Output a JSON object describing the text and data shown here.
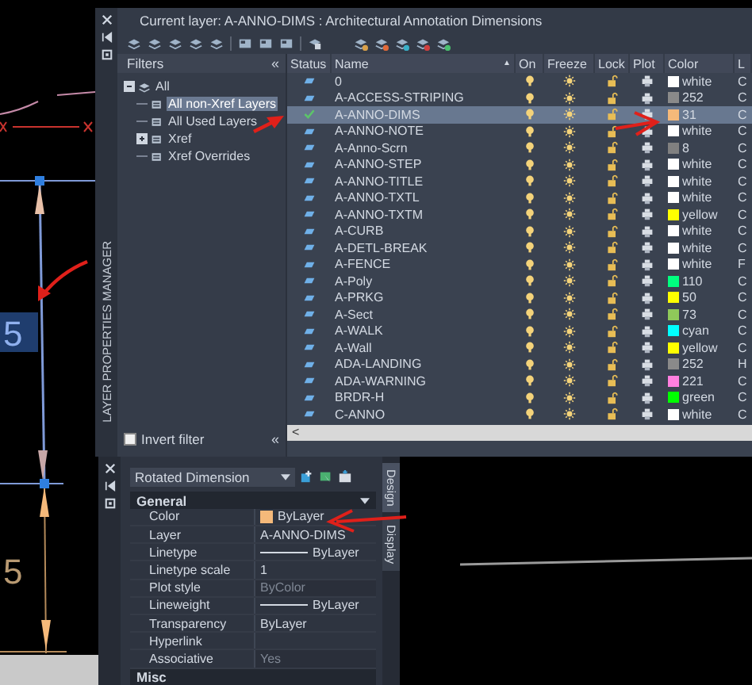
{
  "canvas": {
    "dimension_labels": [
      {
        "text": "5",
        "selected": true
      },
      {
        "text": "5",
        "selected": false
      }
    ]
  },
  "layer_manager": {
    "panel_title": "LAYER PROPERTIES MANAGER",
    "current_layer": "Current layer: A-ANNO-DIMS : Architectural Annotation Dimensions",
    "filters": {
      "title": "Filters",
      "collapse": "«",
      "tree": [
        {
          "label": "All",
          "expanded": true,
          "selected": false,
          "children": [
            {
              "label": "All non-Xref Layers",
              "selected": true
            },
            {
              "label": "All Used Layers",
              "selected": false
            },
            {
              "label": "Xref",
              "selected": false,
              "expanded": false
            },
            {
              "label": "Xref Overrides",
              "selected": false
            }
          ]
        }
      ],
      "invert_filter": {
        "label": "Invert filter",
        "checked": false
      },
      "collapse_button": "«"
    },
    "table": {
      "columns": [
        "Status",
        "Name",
        "On",
        "Freeze",
        "Lock",
        "Plot",
        "Color",
        "L"
      ],
      "sort_indicator": "▲",
      "scroll_left": "<",
      "rows": [
        {
          "name": "0",
          "current": false,
          "selected": false,
          "on": true,
          "frozen": false,
          "locked": false,
          "plot": true,
          "color_name": "white",
          "color": "#ffffff",
          "column_9": "C"
        },
        {
          "name": "A-ACCESS-STRIPING",
          "current": false,
          "selected": false,
          "on": true,
          "frozen": false,
          "locked": false,
          "plot": true,
          "color_name": "252",
          "color": "#8a8a8a",
          "column_9": "C"
        },
        {
          "name": "A-ANNO-DIMS",
          "current": true,
          "selected": true,
          "on": true,
          "frozen": false,
          "locked": false,
          "plot": true,
          "color_name": "31",
          "color": "#f5b97a",
          "column_9": "C"
        },
        {
          "name": "A-ANNO-NOTE",
          "current": false,
          "selected": false,
          "on": true,
          "frozen": false,
          "locked": false,
          "plot": true,
          "color_name": "white",
          "color": "#ffffff",
          "column_9": "C"
        },
        {
          "name": "A-Anno-Scrn",
          "current": false,
          "selected": false,
          "on": true,
          "frozen": false,
          "locked": false,
          "plot": true,
          "color_name": "8",
          "color": "#808080",
          "column_9": "C"
        },
        {
          "name": "A-ANNO-STEP",
          "current": false,
          "selected": false,
          "on": true,
          "frozen": false,
          "locked": false,
          "plot": true,
          "color_name": "white",
          "color": "#ffffff",
          "column_9": "C"
        },
        {
          "name": "A-ANNO-TITLE",
          "current": false,
          "selected": false,
          "on": true,
          "frozen": false,
          "locked": false,
          "plot": true,
          "color_name": "white",
          "color": "#ffffff",
          "column_9": "C"
        },
        {
          "name": "A-ANNO-TXTL",
          "current": false,
          "selected": false,
          "on": true,
          "frozen": false,
          "locked": false,
          "plot": true,
          "color_name": "white",
          "color": "#ffffff",
          "column_9": "C"
        },
        {
          "name": "A-ANNO-TXTM",
          "current": false,
          "selected": false,
          "on": true,
          "frozen": false,
          "locked": false,
          "plot": true,
          "color_name": "yellow",
          "color": "#ffff00",
          "column_9": "C"
        },
        {
          "name": "A-CURB",
          "current": false,
          "selected": false,
          "on": true,
          "frozen": false,
          "locked": false,
          "plot": true,
          "color_name": "white",
          "color": "#ffffff",
          "column_9": "C"
        },
        {
          "name": "A-DETL-BREAK",
          "current": false,
          "selected": false,
          "on": true,
          "frozen": false,
          "locked": false,
          "plot": true,
          "color_name": "white",
          "color": "#ffffff",
          "column_9": "C"
        },
        {
          "name": "A-FENCE",
          "current": false,
          "selected": false,
          "on": true,
          "frozen": false,
          "locked": false,
          "plot": true,
          "color_name": "white",
          "color": "#ffffff",
          "column_9": "F"
        },
        {
          "name": "A-Poly",
          "current": false,
          "selected": false,
          "on": true,
          "frozen": false,
          "locked": false,
          "plot": true,
          "color_name": "110",
          "color": "#00ff7f",
          "column_9": "C"
        },
        {
          "name": "A-PRKG",
          "current": false,
          "selected": false,
          "on": true,
          "frozen": false,
          "locked": false,
          "plot": true,
          "color_name": "50",
          "color": "#ffff00",
          "column_9": "C"
        },
        {
          "name": "A-Sect",
          "current": false,
          "selected": false,
          "on": true,
          "frozen": false,
          "locked": false,
          "plot": true,
          "color_name": "73",
          "color": "#8fc95a",
          "column_9": "C"
        },
        {
          "name": "A-WALK",
          "current": false,
          "selected": false,
          "on": true,
          "frozen": false,
          "locked": false,
          "plot": true,
          "color_name": "cyan",
          "color": "#00ffff",
          "column_9": "C"
        },
        {
          "name": "A-Wall",
          "current": false,
          "selected": false,
          "on": true,
          "frozen": false,
          "locked": false,
          "plot": true,
          "color_name": "yellow",
          "color": "#ffff00",
          "column_9": "C"
        },
        {
          "name": "ADA-LANDING",
          "current": false,
          "selected": false,
          "on": true,
          "frozen": false,
          "locked": false,
          "plot": true,
          "color_name": "252",
          "color": "#8a8a8a",
          "column_9": "H"
        },
        {
          "name": "ADA-WARNING",
          "current": false,
          "selected": false,
          "on": true,
          "frozen": false,
          "locked": false,
          "plot": true,
          "color_name": "221",
          "color": "#ff7fdf",
          "column_9": "C"
        },
        {
          "name": "BRDR-H",
          "current": false,
          "selected": false,
          "on": true,
          "frozen": false,
          "locked": false,
          "plot": true,
          "color_name": "green",
          "color": "#00ff00",
          "column_9": "C"
        },
        {
          "name": "C-ANNO",
          "current": false,
          "selected": false,
          "on": true,
          "frozen": false,
          "locked": false,
          "plot": true,
          "color_name": "white",
          "color": "#ffffff",
          "column_9": "C"
        }
      ]
    }
  },
  "properties": {
    "selector": "Rotated Dimension",
    "general": {
      "title": "General",
      "expanded": true,
      "rows": [
        {
          "label": "Color",
          "value": "ByLayer",
          "kind": "swatch",
          "color": "#f5b97a",
          "dimmed": false
        },
        {
          "label": "Layer",
          "value": "A-ANNO-DIMS",
          "kind": "text",
          "dimmed": false
        },
        {
          "label": "Linetype",
          "value": "ByLayer",
          "kind": "line",
          "dimmed": false
        },
        {
          "label": "Linetype scale",
          "value": "1",
          "kind": "text",
          "dimmed": false
        },
        {
          "label": "Plot style",
          "value": "ByColor",
          "kind": "text",
          "dimmed": true
        },
        {
          "label": "Lineweight",
          "value": "ByLayer",
          "kind": "line",
          "dimmed": false
        },
        {
          "label": "Transparency",
          "value": "ByLayer",
          "kind": "text",
          "dimmed": false
        },
        {
          "label": "Hyperlink",
          "kind": "text",
          "dimmed": false
        },
        {
          "label": "Associative",
          "value": "Yes",
          "kind": "text",
          "dimmed": true
        }
      ]
    },
    "misc": {
      "title": "Misc"
    },
    "tabs": [
      {
        "label": "Design",
        "selected": true
      },
      {
        "label": "Display",
        "selected": false
      }
    ]
  }
}
